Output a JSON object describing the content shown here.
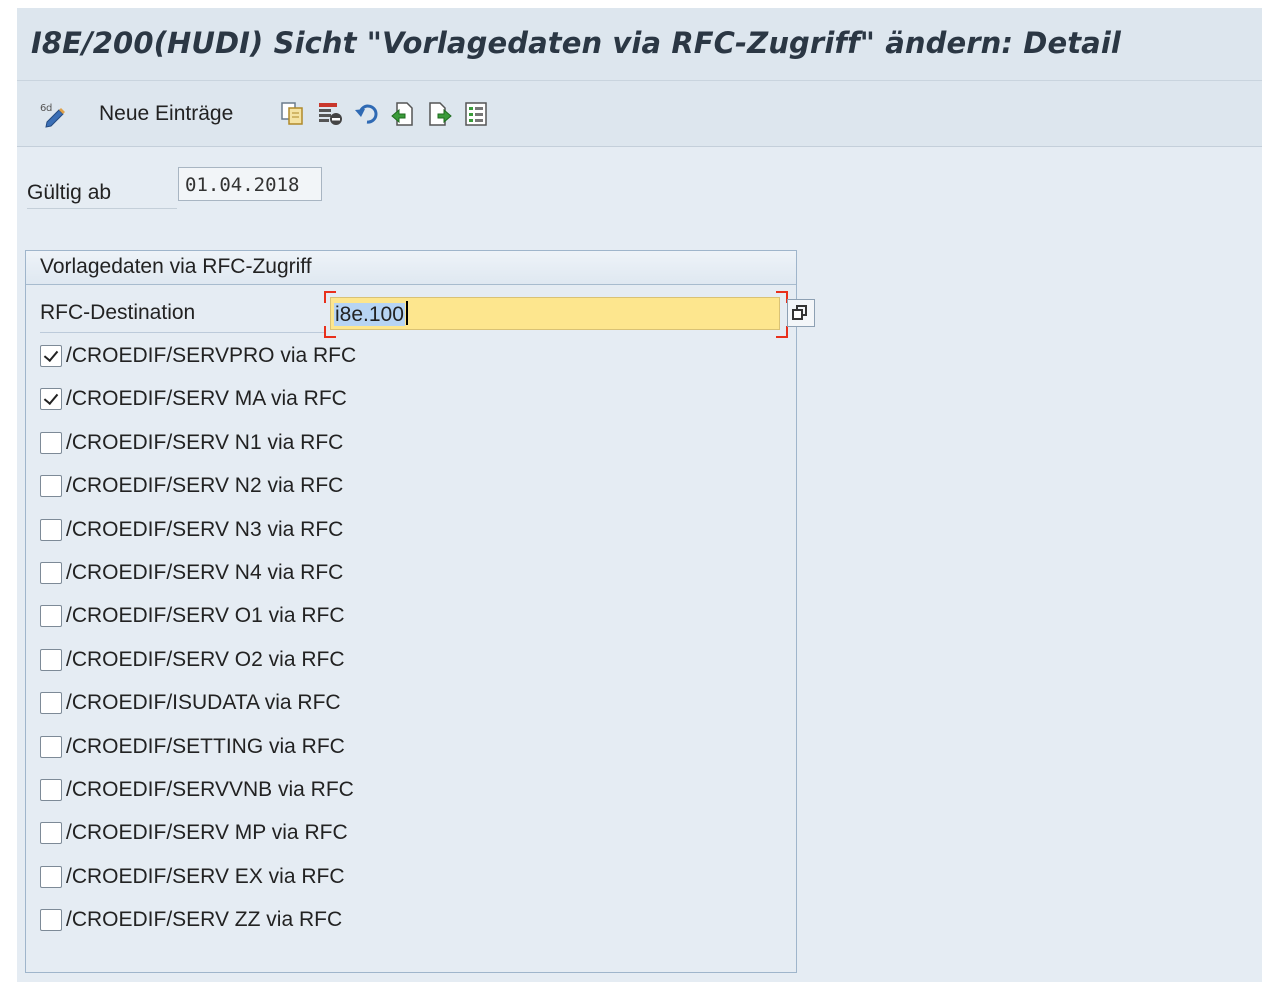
{
  "window": {
    "title": "I8E/200(HUDI) Sicht \"Vorlagedaten via RFC-Zugriff\" ändern: Detail"
  },
  "toolbar": {
    "items": [
      {
        "name": "display-change-icon",
        "label": ""
      },
      {
        "name": "neue-eintraege-button",
        "label": "Neue Einträge"
      },
      {
        "name": "copy-as-icon",
        "label": ""
      },
      {
        "name": "delete-icon",
        "label": ""
      },
      {
        "name": "undo-change-icon",
        "label": ""
      },
      {
        "name": "previous-entry-icon",
        "label": ""
      },
      {
        "name": "next-entry-icon",
        "label": ""
      },
      {
        "name": "select-all-icon",
        "label": ""
      }
    ]
  },
  "valid_from": {
    "label": "Gültig ab",
    "value": "01.04.2018"
  },
  "group": {
    "title": "Vorlagedaten via RFC-Zugriff",
    "rfc_destination": {
      "label": "RFC-Destination",
      "value": "i8e.100"
    },
    "checkboxes": [
      {
        "label": "/CROEDIF/SERVPRO via RFC",
        "checked": true
      },
      {
        "label": "/CROEDIF/SERV MA via RFC",
        "checked": true
      },
      {
        "label": "/CROEDIF/SERV N1 via RFC",
        "checked": false
      },
      {
        "label": "/CROEDIF/SERV N2 via RFC",
        "checked": false
      },
      {
        "label": "/CROEDIF/SERV N3 via RFC",
        "checked": false
      },
      {
        "label": "/CROEDIF/SERV N4 via RFC",
        "checked": false
      },
      {
        "label": "/CROEDIF/SERV O1 via RFC",
        "checked": false
      },
      {
        "label": "/CROEDIF/SERV O2 via RFC",
        "checked": false
      },
      {
        "label": "/CROEDIF/ISUDATA via RFC",
        "checked": false
      },
      {
        "label": "/CROEDIF/SETTING via RFC",
        "checked": false
      },
      {
        "label": "/CROEDIF/SERVVNB via RFC",
        "checked": false
      },
      {
        "label": "/CROEDIF/SERV MP via RFC",
        "checked": false
      },
      {
        "label": "/CROEDIF/SERV EX via RFC",
        "checked": false
      },
      {
        "label": "/CROEDIF/SERV ZZ via RFC",
        "checked": false
      }
    ]
  },
  "colors": {
    "title_text": "#2b3744",
    "background": "#e5ecf3",
    "input_highlight": "#fde68e",
    "focus_corner": "#e8301c"
  }
}
